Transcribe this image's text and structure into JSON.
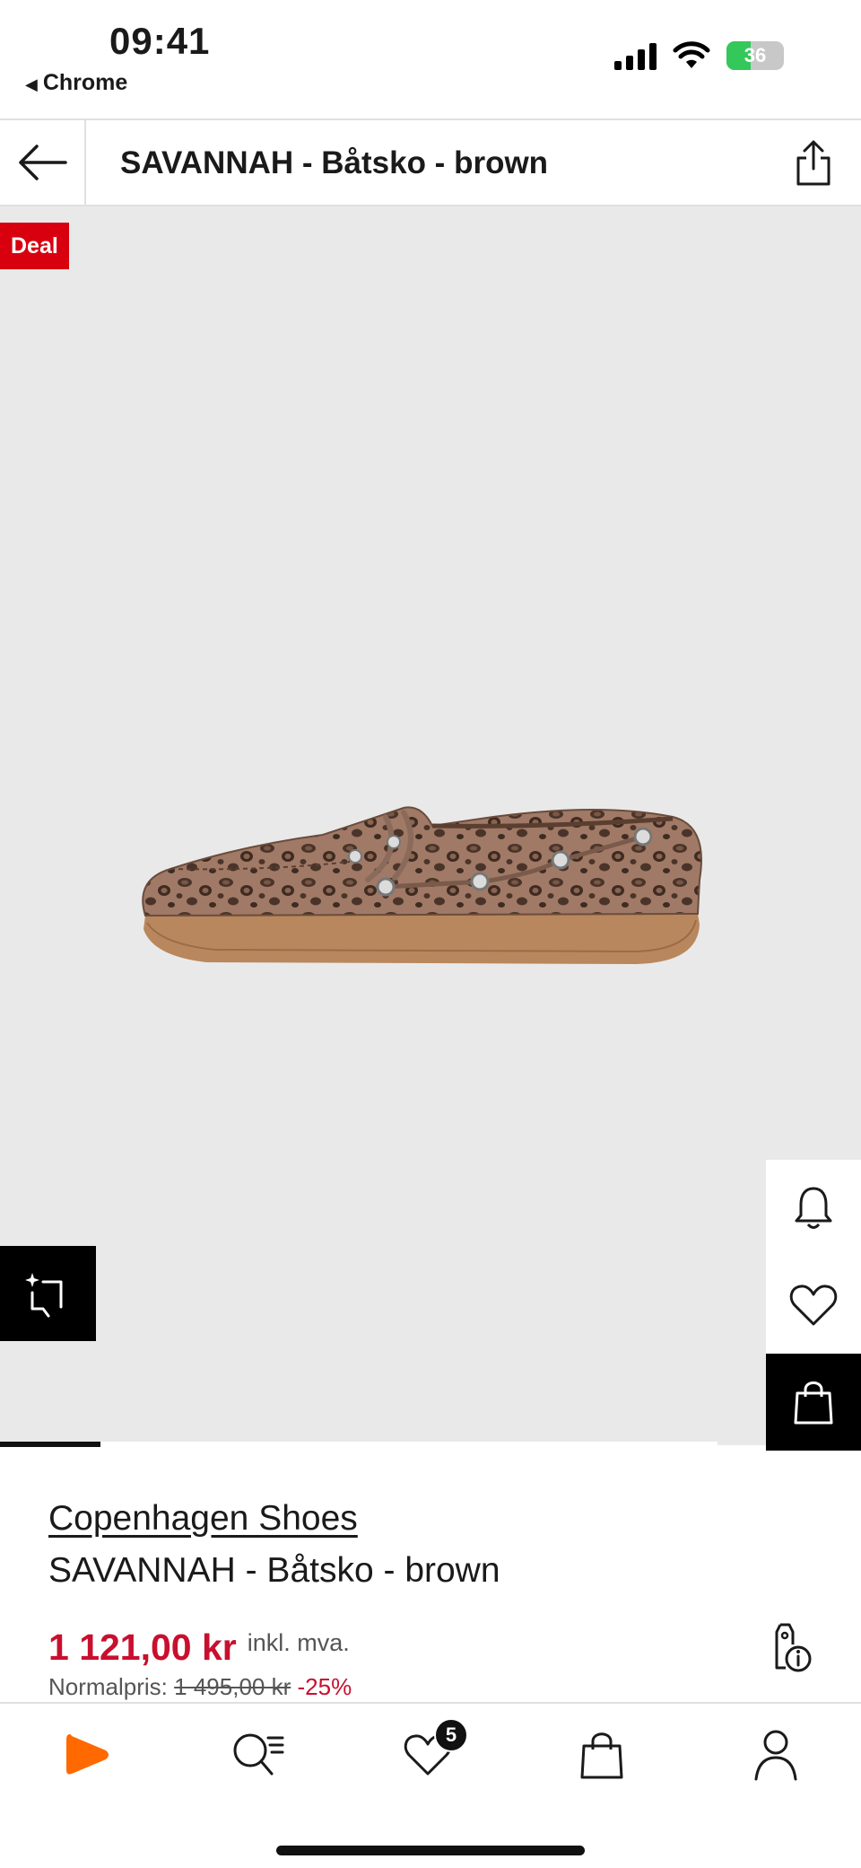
{
  "status_bar": {
    "time": "09:41",
    "back_app": "Chrome",
    "battery": "36"
  },
  "header": {
    "title": "SAVANNAH - Båtsko - brown"
  },
  "gallery": {
    "deal_badge": "Deal",
    "image_progress": 0.14
  },
  "product": {
    "brand": "Copenhagen Shoes",
    "name": "SAVANNAH - Båtsko - brown",
    "price": "1 121,00 kr",
    "vat_note": "inkl. mva.",
    "normal_label": "Normalpris:",
    "normal_price": "1 495,00 kr",
    "discount": "-25%"
  },
  "nav": {
    "wishlist_count": "5"
  },
  "colors": {
    "accent_red": "#c8102e",
    "deal_red": "#d8000f",
    "brand_orange": "#ff6900",
    "battery_green": "#34c759"
  }
}
